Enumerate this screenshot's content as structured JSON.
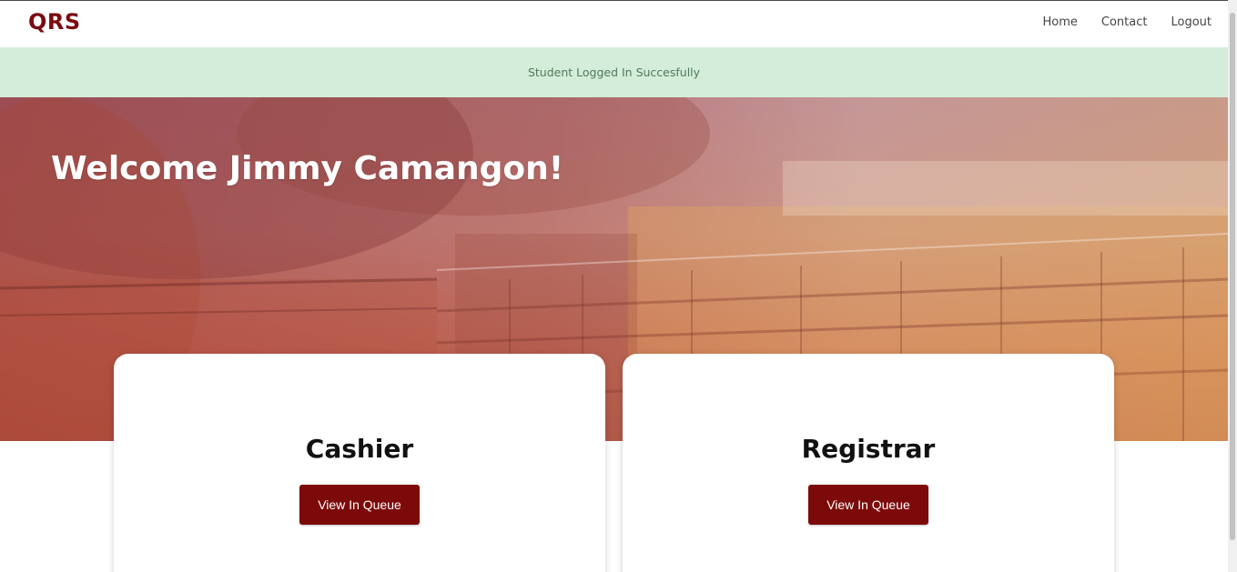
{
  "navbar": {
    "brand": "QRS",
    "links": [
      "Home",
      "Contact",
      "Logout"
    ]
  },
  "alert": {
    "message": "Student Logged In Succesfully"
  },
  "hero": {
    "title": "Welcome Jimmy Camangon!"
  },
  "cards": [
    {
      "title": "Cashier",
      "button_label": "View In Queue"
    },
    {
      "title": "Registrar",
      "button_label": "View In Queue"
    }
  ],
  "colors": {
    "brand": "#7a0c10",
    "button": "#7d0a0a",
    "alert_bg": "#d4edda",
    "alert_text": "#4f7a59"
  }
}
